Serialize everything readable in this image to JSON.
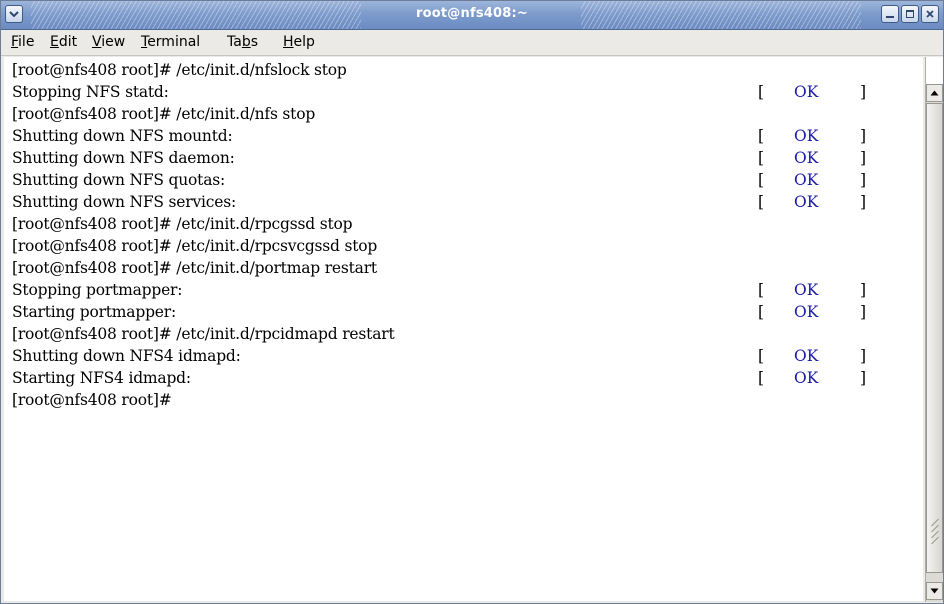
{
  "window": {
    "title": "root@nfs408:~"
  },
  "menubar": {
    "items": [
      {
        "prefix": "",
        "accel": "F",
        "rest": "ile"
      },
      {
        "prefix": "",
        "accel": "E",
        "rest": "dit"
      },
      {
        "prefix": "",
        "accel": "V",
        "rest": "iew"
      },
      {
        "prefix": "",
        "accel": "T",
        "rest": "erminal"
      },
      {
        "prefix": "Ta",
        "accel": "b",
        "rest": "s"
      },
      {
        "prefix": "",
        "accel": "H",
        "rest": "elp"
      }
    ]
  },
  "terminal": {
    "lines": [
      {
        "text": "[root@nfs408 root]# /etc/init.d/nfslock stop"
      },
      {
        "text": "Stopping NFS statd:"
      },
      {
        "text": "[root@nfs408 root]# /etc/init.d/nfs stop"
      },
      {
        "text": "Shutting down NFS mountd:"
      },
      {
        "text": "Shutting down NFS daemon:"
      },
      {
        "text": "Shutting down NFS quotas:"
      },
      {
        "text": "Shutting down NFS services:"
      },
      {
        "text": "[root@nfs408 root]# /etc/init.d/rpcgssd stop"
      },
      {
        "text": "[root@nfs408 root]# /etc/init.d/rpcsvcgssd stop"
      },
      {
        "text": "[root@nfs408 root]# /etc/init.d/portmap restart"
      },
      {
        "text": "Stopping portmapper:"
      },
      {
        "text": "Starting portmapper:"
      },
      {
        "text": "[root@nfs408 root]# /etc/init.d/rpcidmapd restart"
      },
      {
        "text": "Shutting down NFS4 idmapd:"
      },
      {
        "text": "Starting NFS4 idmapd:"
      },
      {
        "text": "[root@nfs408 root]#"
      }
    ],
    "status": {
      "left_bracket": "[",
      "ok": "OK",
      "right_bracket": "]",
      "ok_color": "#1a1aa8",
      "lines_with_ok": [
        1,
        3,
        4,
        5,
        6,
        10,
        11,
        13,
        14
      ]
    }
  },
  "icons": {
    "window_menu": "window-menu-icon",
    "minimize": "minimize-icon",
    "maximize": "maximize-icon",
    "close": "close-icon",
    "scroll_up": "scroll-up-arrow-icon",
    "scroll_down": "scroll-down-arrow-icon"
  },
  "colors": {
    "titlebar": "#7d9bcc",
    "terminal_bg": "#ffffff",
    "text": "#000000"
  }
}
